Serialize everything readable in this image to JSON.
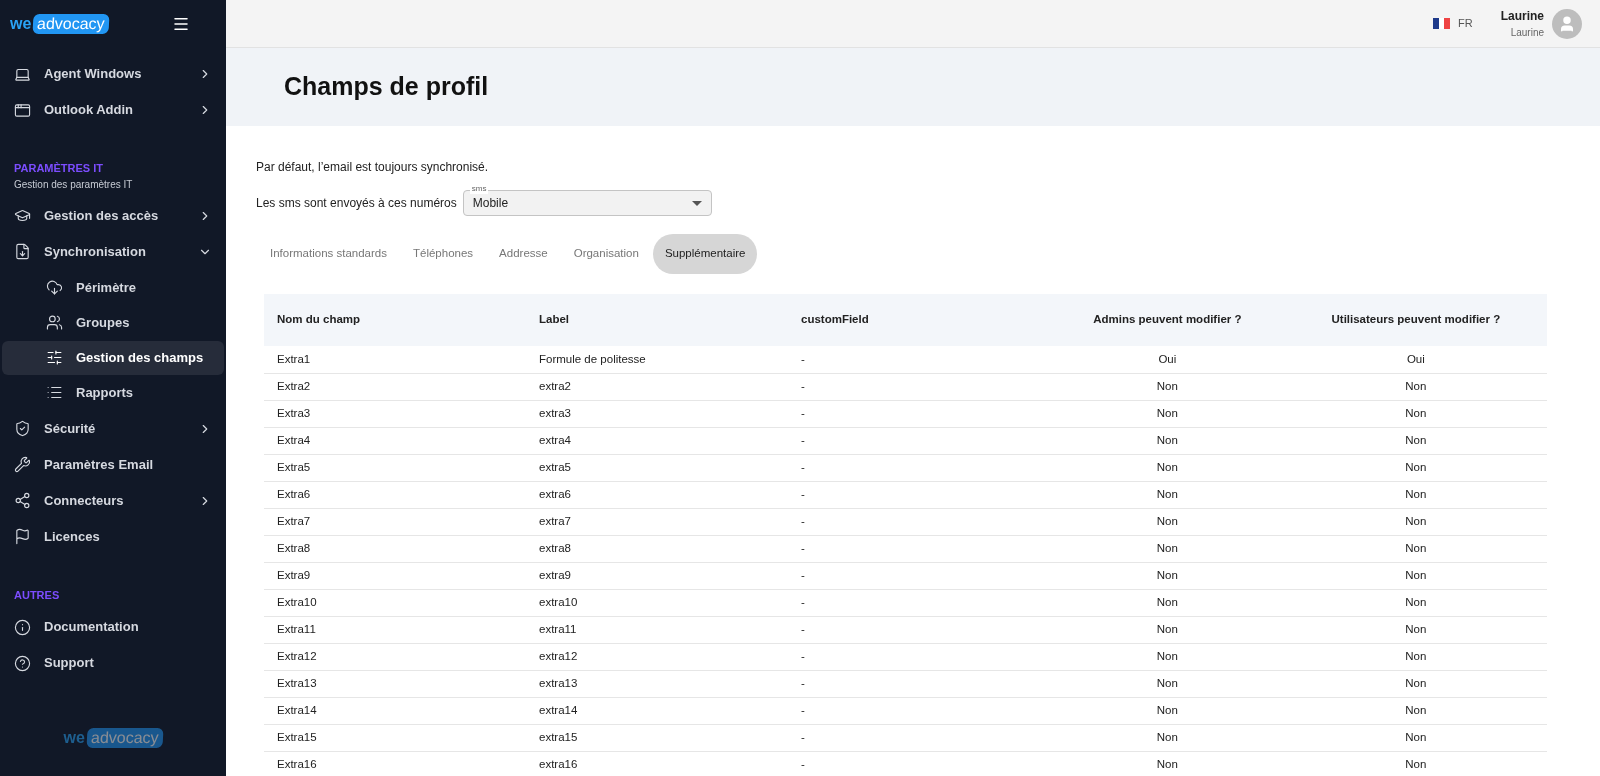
{
  "sidebar": {
    "logo": {
      "we": "we",
      "brand": "advocacy"
    },
    "top_items": [
      {
        "label": "Agent Windows",
        "kind": "group",
        "expanded": false
      },
      {
        "label": "Outlook Addin",
        "kind": "group",
        "expanded": false
      }
    ],
    "sections": [
      {
        "title": "PARAMÈTRES IT",
        "subtitle": "Gestion des paramètres IT",
        "items": [
          {
            "label": "Gestion des accès",
            "kind": "group",
            "expanded": false
          },
          {
            "label": "Synchronisation",
            "kind": "group",
            "expanded": true,
            "children": [
              {
                "label": "Périmètre",
                "selected": false
              },
              {
                "label": "Groupes",
                "selected": false
              },
              {
                "label": "Gestion des champs",
                "selected": true
              },
              {
                "label": "Rapports",
                "selected": false
              }
            ]
          },
          {
            "label": "Sécurité",
            "kind": "group",
            "expanded": false
          },
          {
            "label": "Paramètres Email",
            "kind": "link"
          },
          {
            "label": "Connecteurs",
            "kind": "group",
            "expanded": false
          },
          {
            "label": "Licences",
            "kind": "link"
          }
        ]
      },
      {
        "title": "AUTRES",
        "items": [
          {
            "label": "Documentation",
            "kind": "link"
          },
          {
            "label": "Support",
            "kind": "link"
          }
        ]
      }
    ],
    "footer_logo": {
      "we": "we",
      "brand": "advocacy"
    }
  },
  "header": {
    "language": "FR",
    "user_name": "Laurine",
    "user_sub": "Laurine"
  },
  "page_title": "Champs de profil",
  "email_note": "Par défaut, l’email est toujours synchronisé.",
  "sms": {
    "label": "Les sms sont envoyés à ces numéros",
    "field_label": "sms",
    "value": "Mobile"
  },
  "tabs": [
    {
      "label": "Informations standards",
      "selected": false
    },
    {
      "label": "Téléphones",
      "selected": false
    },
    {
      "label": "Addresse",
      "selected": false
    },
    {
      "label": "Organisation",
      "selected": false
    },
    {
      "label": "Supplémentaire",
      "selected": true
    }
  ],
  "table": {
    "columns": [
      {
        "label": "Nom du champ",
        "kind": "text"
      },
      {
        "label": "Label",
        "kind": "text"
      },
      {
        "label": "customField",
        "kind": "text"
      },
      {
        "label": "Admins peuvent modifier ?",
        "kind": "yes_no"
      },
      {
        "label": "Utilisateurs peuvent modifier ?",
        "kind": "yes_no"
      }
    ],
    "rows": [
      [
        "Extra1",
        "Formule de politesse",
        "-",
        "Oui",
        "Oui"
      ],
      [
        "Extra2",
        "extra2",
        "-",
        "Non",
        "Non"
      ],
      [
        "Extra3",
        "extra3",
        "-",
        "Non",
        "Non"
      ],
      [
        "Extra4",
        "extra4",
        "-",
        "Non",
        "Non"
      ],
      [
        "Extra5",
        "extra5",
        "-",
        "Non",
        "Non"
      ],
      [
        "Extra6",
        "extra6",
        "-",
        "Non",
        "Non"
      ],
      [
        "Extra7",
        "extra7",
        "-",
        "Non",
        "Non"
      ],
      [
        "Extra8",
        "extra8",
        "-",
        "Non",
        "Non"
      ],
      [
        "Extra9",
        "extra9",
        "-",
        "Non",
        "Non"
      ],
      [
        "Extra10",
        "extra10",
        "-",
        "Non",
        "Non"
      ],
      [
        "Extra11",
        "extra11",
        "-",
        "Non",
        "Non"
      ],
      [
        "Extra12",
        "extra12",
        "-",
        "Non",
        "Non"
      ],
      [
        "Extra13",
        "extra13",
        "-",
        "Non",
        "Non"
      ],
      [
        "Extra14",
        "extra14",
        "-",
        "Non",
        "Non"
      ],
      [
        "Extra15",
        "extra15",
        "-",
        "Non",
        "Non"
      ],
      [
        "Extra16",
        "extra16",
        "-",
        "Non",
        "Non"
      ]
    ]
  }
}
